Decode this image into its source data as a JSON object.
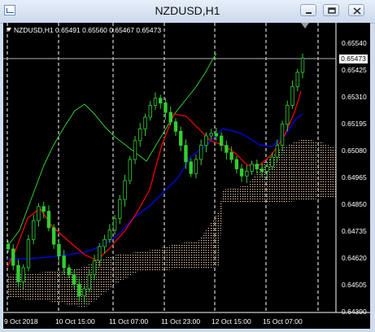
{
  "window": {
    "title": "NZDUSD,H1",
    "icons": [
      "chart-window-icon",
      "minimize-icon",
      "restore-icon",
      "close-icon"
    ]
  },
  "legend": {
    "symbol": "NZDUSD,H1",
    "open": "0.65491",
    "high": "0.65560",
    "low": "0.65467",
    "close": "0.65473"
  },
  "current_price": "0.65473",
  "y_axis": {
    "labels": [
      "0.65540",
      "0.65425",
      "0.65310",
      "0.65195",
      "0.65080",
      "0.64965",
      "0.64850",
      "0.64735",
      "0.64620",
      "0.64505",
      "0.64390"
    ]
  },
  "x_axis": {
    "labels": [
      "9 Oct 2018",
      "10 Oct 15:00",
      "11 Oct 07:00",
      "11 Oct 23:00",
      "12 Oct 15:00",
      "15 Oct 07:00"
    ]
  },
  "colors": {
    "background": "#000000",
    "candles": "#32cd32",
    "tenkan": "#ff0000",
    "kijun": "#0000ff",
    "chikou": "#32cd32",
    "kumo": "#f5cfa8",
    "grid": "#ffffff"
  },
  "chart_data": {
    "type": "candlestick-ichimoku",
    "symbol": "NZDUSD",
    "timeframe": "H1",
    "ylim": [
      0.6439,
      0.656
    ],
    "grid": true,
    "x_ticks": [
      "9 Oct 2018",
      "10 Oct 15:00",
      "11 Oct 07:00",
      "11 Oct 23:00",
      "12 Oct 15:00",
      "15 Oct 07:00"
    ],
    "close_series": [
      0.6466,
      0.6459,
      0.6452,
      0.6458,
      0.647,
      0.6478,
      0.6484,
      0.6482,
      0.6475,
      0.6468,
      0.6463,
      0.6458,
      0.6455,
      0.6451,
      0.6446,
      0.6449,
      0.6455,
      0.6461,
      0.6467,
      0.647,
      0.6474,
      0.6479,
      0.6487,
      0.6495,
      0.6504,
      0.6512,
      0.6517,
      0.6522,
      0.6527,
      0.653,
      0.6528,
      0.6524,
      0.652,
      0.6516,
      0.651,
      0.6503,
      0.6498,
      0.6504,
      0.651,
      0.6514,
      0.6515,
      0.6514,
      0.651,
      0.6507,
      0.6504,
      0.65,
      0.6497,
      0.6499,
      0.6502,
      0.65,
      0.6499,
      0.6501,
      0.6505,
      0.651,
      0.6519,
      0.6527,
      0.6535,
      0.6541,
      0.6547
    ]
  }
}
